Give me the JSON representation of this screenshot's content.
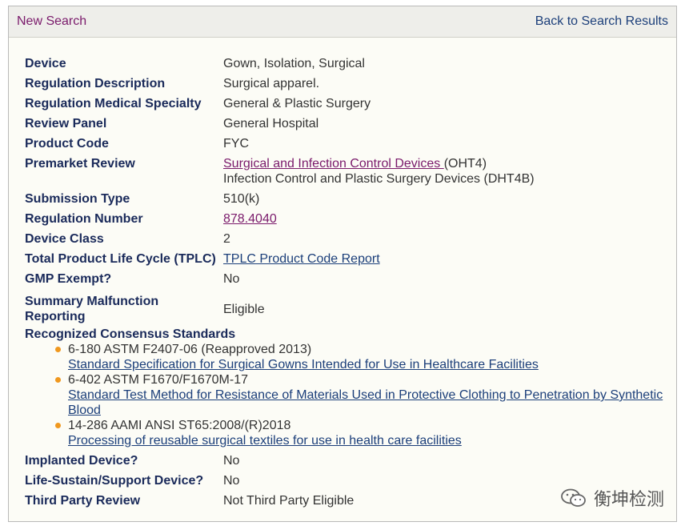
{
  "nav": {
    "new_search": "New Search",
    "back_results": "Back to Search Results"
  },
  "fields": {
    "device": {
      "label": "Device",
      "value": "Gown, Isolation, Surgical"
    },
    "regulation_description": {
      "label": "Regulation Description",
      "value": "Surgical apparel."
    },
    "regulation_specialty": {
      "label": "Regulation Medical Specialty",
      "value": "General & Plastic Surgery"
    },
    "review_panel": {
      "label": "Review Panel",
      "value": "General Hospital"
    },
    "product_code": {
      "label": "Product Code",
      "value": "FYC"
    },
    "premarket_review": {
      "label": "Premarket Review",
      "link": "Surgical and Infection Control Devices ",
      "link_suffix": "(OHT4)",
      "line2": "Infection Control and Plastic Surgery Devices (DHT4B)"
    },
    "submission_type": {
      "label": "Submission Type",
      "value": "510(k)"
    },
    "regulation_number": {
      "label": "Regulation Number",
      "value": "878.4040"
    },
    "device_class": {
      "label": "Device Class",
      "value": "2"
    },
    "tplc": {
      "label": "Total Product Life Cycle (TPLC)",
      "value": "TPLC Product Code Report"
    },
    "gmp_exempt": {
      "label": "GMP Exempt?",
      "value": "No"
    },
    "summary_malfunction": {
      "label_line1": "Summary Malfunction",
      "label_line2": "Reporting",
      "value": "Eligible"
    },
    "consensus_standards": {
      "label": "Recognized Consensus Standards",
      "items": [
        {
          "code": "6-180 ASTM F2407-06 (Reapproved 2013)",
          "title": "Standard Specification for Surgical Gowns Intended for Use in Healthcare Facilities"
        },
        {
          "code": "6-402 ASTM F1670/F1670M-17",
          "title": "Standard Test Method for Resistance of Materials Used in Protective Clothing to Penetration by Synthetic Blood"
        },
        {
          "code": "14-286 AAMI ANSI ST65:2008/(R)2018",
          "title": "Processing of reusable surgical textiles for use in health care facilities"
        }
      ]
    },
    "implanted": {
      "label": "Implanted Device?",
      "value": "No"
    },
    "life_sustain": {
      "label": "Life-Sustain/Support Device?",
      "value": "No"
    },
    "third_party": {
      "label": "Third Party Review",
      "value": "Not Third Party Eligible"
    }
  },
  "watermark": {
    "text": "衡坤检测",
    "icon": "wechat-icon"
  },
  "colors": {
    "link_purple": "#7a1a6b",
    "link_blue": "#1c3f7a",
    "label_navy": "#1a2a5a",
    "bullet_orange": "#f0981e"
  }
}
